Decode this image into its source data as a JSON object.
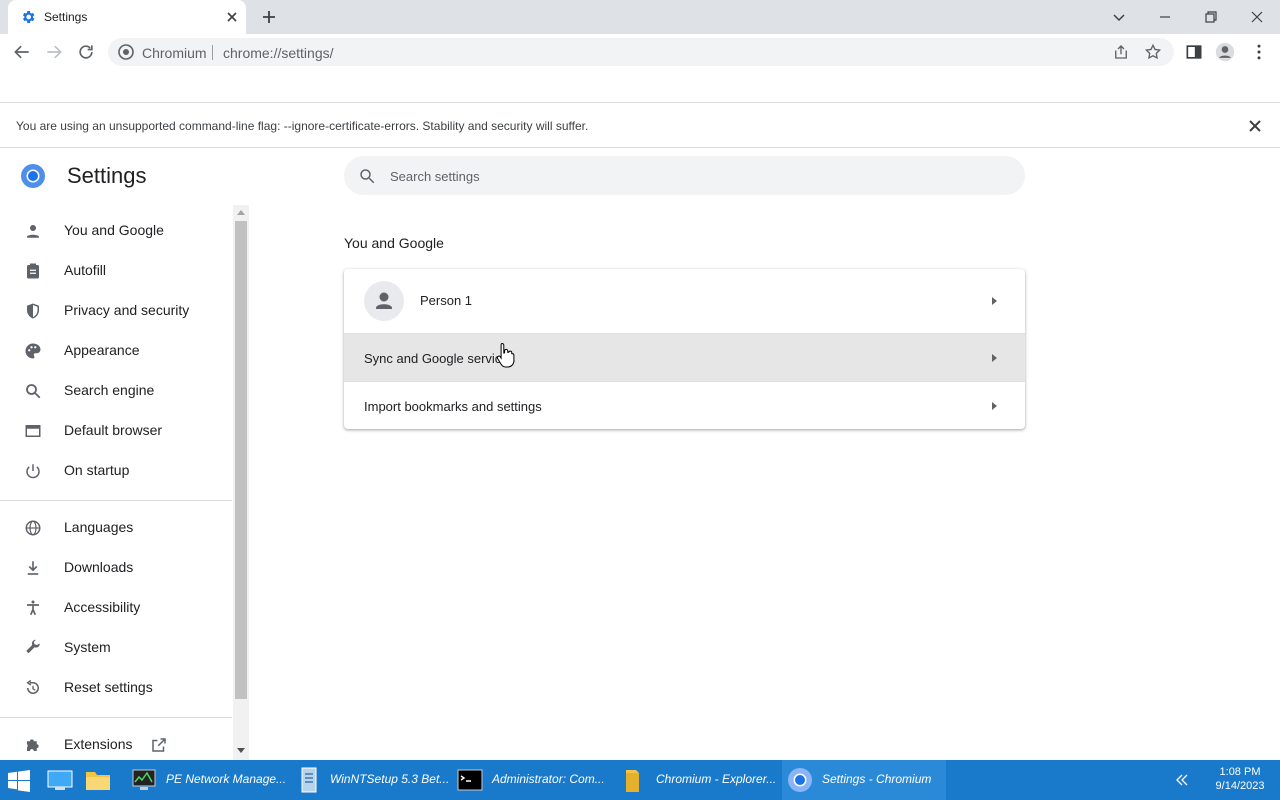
{
  "tab": {
    "title": "Settings",
    "favicon": "gear-icon"
  },
  "toolbar": {
    "site_label": "Chromium",
    "url": "chrome://settings/"
  },
  "infobar": {
    "message": "You are using an unsupported command-line flag: --ignore-certificate-errors. Stability and security will suffer."
  },
  "settings": {
    "title": "Settings",
    "search_placeholder": "Search settings"
  },
  "sidebar": {
    "items": [
      {
        "label": "You and Google",
        "icon": "person-icon"
      },
      {
        "label": "Autofill",
        "icon": "clipboard-icon"
      },
      {
        "label": "Privacy and security",
        "icon": "shield-icon"
      },
      {
        "label": "Appearance",
        "icon": "palette-icon"
      },
      {
        "label": "Search engine",
        "icon": "search-icon"
      },
      {
        "label": "Default browser",
        "icon": "browser-icon"
      },
      {
        "label": "On startup",
        "icon": "power-icon"
      },
      {
        "label": "Languages",
        "icon": "globe-icon"
      },
      {
        "label": "Downloads",
        "icon": "download-icon"
      },
      {
        "label": "Accessibility",
        "icon": "accessibility-icon"
      },
      {
        "label": "System",
        "icon": "wrench-icon"
      },
      {
        "label": "Reset settings",
        "icon": "reset-icon"
      },
      {
        "label": "Extensions",
        "icon": "puzzle-icon"
      }
    ]
  },
  "main": {
    "section_title": "You and Google",
    "rows": [
      {
        "label": "Person 1"
      },
      {
        "label": "Sync and Google services"
      },
      {
        "label": "Import bookmarks and settings"
      }
    ]
  },
  "taskbar": {
    "apps": [
      {
        "label": "PE Network Manage..."
      },
      {
        "label": "WinNTSetup 5.3 Bet..."
      },
      {
        "label": "Administrator: Com..."
      },
      {
        "label": "Chromium - Explorer..."
      },
      {
        "label": "Settings - Chromium"
      }
    ],
    "time": "1:08 PM",
    "date": "9/14/2023"
  },
  "colors": {
    "accent": "#1a73e8",
    "taskbar": "#1979ca",
    "icon_gray": "#5f6368"
  }
}
